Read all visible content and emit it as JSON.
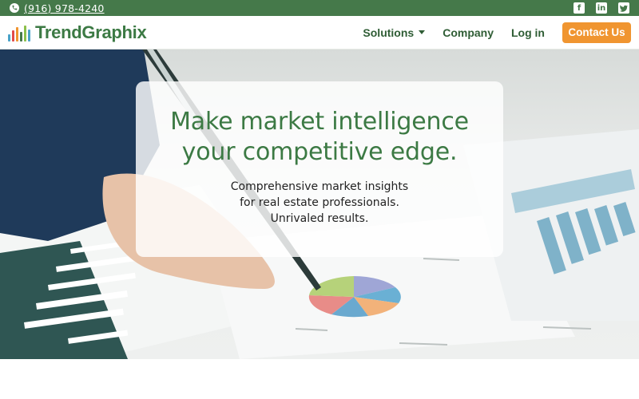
{
  "topbar": {
    "phone": "(916) 978-4240",
    "social_icons": [
      "facebook-icon",
      "linkedin-icon",
      "twitter-icon"
    ]
  },
  "brand": {
    "name": "TrendGraphix"
  },
  "nav": {
    "items": [
      {
        "label": "Solutions",
        "has_dropdown": true
      },
      {
        "label": "Company",
        "has_dropdown": false
      },
      {
        "label": "Log in",
        "has_dropdown": false
      }
    ],
    "cta": "Contact Us"
  },
  "hero": {
    "title_line1": "Make market intelligence",
    "title_line2": "your competitive edge.",
    "sub_line1": "Comprehensive market insights",
    "sub_line2": "for real estate professionals.",
    "sub_line3": "Unrivaled results."
  },
  "colors": {
    "brand_green": "#45794a",
    "title_green": "#3c7a44",
    "cta_orange": "#f09530"
  }
}
